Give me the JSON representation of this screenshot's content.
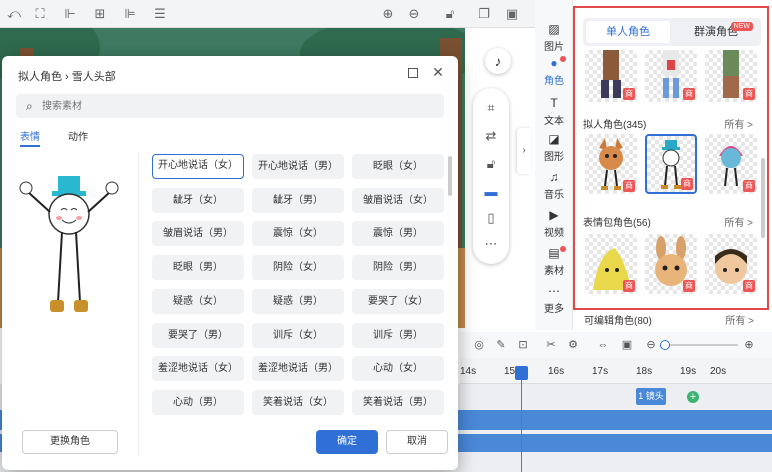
{
  "toolbar": {
    "icons": [
      "undo-icon",
      "fit-icon",
      "align-left-icon",
      "align-center-icon",
      "align-right-icon",
      "distribute-icon",
      "zoom-in-icon",
      "zoom-out-icon",
      "lock-icon",
      "copy-icon",
      "delete-icon"
    ]
  },
  "float_toolbar": {
    "music_icon": "music-note-icon",
    "icons": [
      "screenshot-icon",
      "flip-icon",
      "lock-icon",
      "monitor-icon",
      "phone-icon",
      "more-icon"
    ]
  },
  "categories": [
    {
      "label": "图片",
      "icon": "image-icon",
      "active": false,
      "dot": false
    },
    {
      "label": "角色",
      "icon": "person-icon",
      "active": true,
      "dot": true
    },
    {
      "label": "文本",
      "icon": "text-icon",
      "active": false,
      "dot": false
    },
    {
      "label": "图形",
      "icon": "shape-icon",
      "active": false,
      "dot": false
    },
    {
      "label": "音乐",
      "icon": "music-icon",
      "active": false,
      "dot": false
    },
    {
      "label": "视频",
      "icon": "video-icon",
      "active": false,
      "dot": false
    },
    {
      "label": "素材",
      "icon": "material-icon",
      "active": false,
      "dot": true
    },
    {
      "label": "更多",
      "icon": "more-icon",
      "active": false,
      "dot": false
    }
  ],
  "panel": {
    "tab_single": "单人角色",
    "tab_group": "群演角色",
    "new_badge": "NEW",
    "section1_title": "拟人角色(345)",
    "section2_title": "表情包角色(56)",
    "section3_title": "可编辑角色(80)",
    "more_label": "所有 >",
    "premium_badge": "商"
  },
  "timeline": {
    "ticks": [
      "14s",
      "15s",
      "16s",
      "17s",
      "18s",
      "19s",
      "20s"
    ],
    "shot_label": "1 镜头",
    "add_label": "+"
  },
  "dialog": {
    "breadcrumb": "拟人角色 › 雪人头部",
    "search_placeholder": "搜索素材",
    "tab_expression": "表情",
    "tab_action": "动作",
    "swap_button": "更换角色",
    "ok_button": "确定",
    "cancel_button": "取消",
    "expressions": [
      "开心地说话（女）",
      "开心地说话（男）",
      "眨眼（女）",
      "龇牙（女）",
      "龇牙（男）",
      "皱眉说话（女）",
      "皱眉说话（男）",
      "震惊（女）",
      "震惊（男）",
      "眨眼（男）",
      "阴险（女）",
      "阴险（男）",
      "疑惑（女）",
      "疑惑（男）",
      "要哭了（女）",
      "要哭了（男）",
      "训斥（女）",
      "训斥（男）",
      "羞涩地说话（女）",
      "羞涩地说话（男）",
      "心动（女）",
      "心动（男）",
      "笑着说话（女）",
      "笑着说话（男）"
    ]
  },
  "colors": {
    "accent": "#2f6fd6",
    "highlight_border": "#e34848",
    "premium": "#ee5555"
  }
}
